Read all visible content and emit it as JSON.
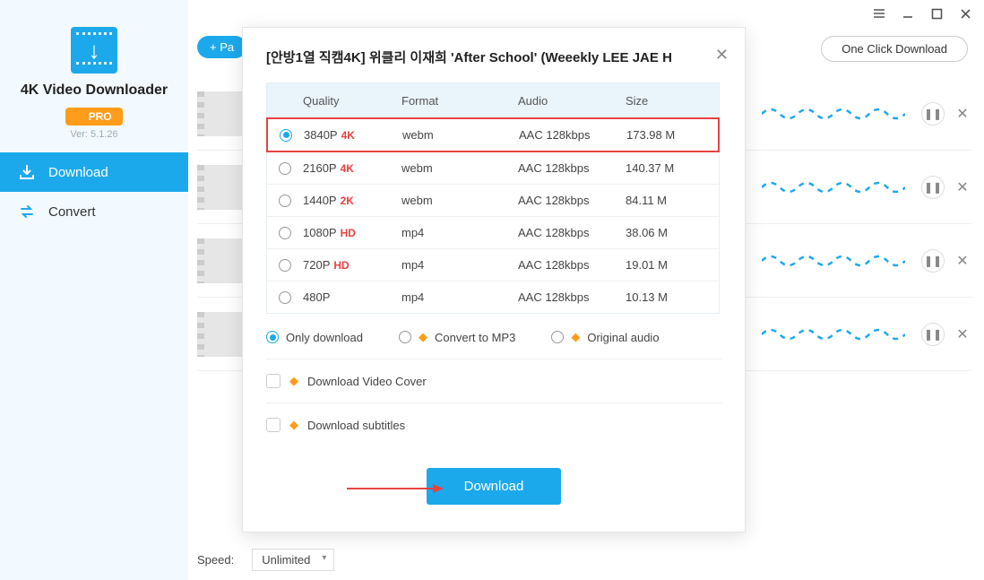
{
  "window": {
    "one_click": "One Click Download"
  },
  "sidebar": {
    "title": "4K Video Downloader",
    "pro": "PRO",
    "version": "Ver: 5.1.26",
    "nav": {
      "download": "Download",
      "convert": "Convert"
    }
  },
  "toolbar": {
    "paste": "+ Pa"
  },
  "footer": {
    "speed_label": "Speed:",
    "speed_value": "Unlimited"
  },
  "modal": {
    "title": "[안방1열 직캠4K] 위클리 이재희 'After School' (Weeekly LEE JAE H",
    "headers": {
      "quality": "Quality",
      "format": "Format",
      "audio": "Audio",
      "size": "Size"
    },
    "rows": [
      {
        "quality": "3840P",
        "tag": "4K",
        "format": "webm",
        "audio": "AAC 128kbps",
        "size": "173.98 M",
        "selected": true
      },
      {
        "quality": "2160P",
        "tag": "4K",
        "format": "webm",
        "audio": "AAC 128kbps",
        "size": "140.37 M",
        "selected": false
      },
      {
        "quality": "1440P",
        "tag": "2K",
        "format": "webm",
        "audio": "AAC 128kbps",
        "size": "84.11 M",
        "selected": false
      },
      {
        "quality": "1080P",
        "tag": "HD",
        "format": "mp4",
        "audio": "AAC 128kbps",
        "size": "38.06 M",
        "selected": false
      },
      {
        "quality": "720P",
        "tag": "HD",
        "format": "mp4",
        "audio": "AAC 128kbps",
        "size": "19.01 M",
        "selected": false
      },
      {
        "quality": "480P",
        "tag": "",
        "format": "mp4",
        "audio": "AAC 128kbps",
        "size": "10.13 M",
        "selected": false
      }
    ],
    "modes": {
      "only_download": "Only download",
      "convert_mp3": "Convert to MP3",
      "original_audio": "Original audio"
    },
    "options": {
      "cover": "Download Video Cover",
      "subtitles": "Download subtitles"
    },
    "download_btn": "Download"
  },
  "icons": {
    "pause": "❚❚",
    "close": "✕"
  }
}
